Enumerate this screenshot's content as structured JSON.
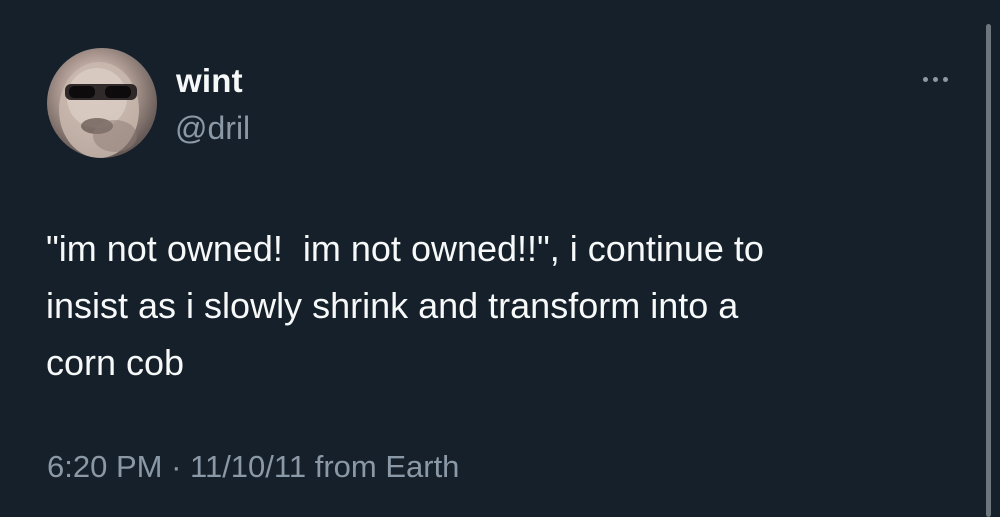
{
  "user": {
    "display_name": "wint",
    "handle": "@dril",
    "avatar_icon": "avatar-icon"
  },
  "tweet": {
    "text": "\"im not owned!  im not owned!!\", i continue to\ninsist as i slowly shrink and transform into a\ncorn cob",
    "time": "6:20 PM",
    "separator": " · ",
    "date": "11/10/11",
    "source": "from Earth"
  },
  "actions": {
    "more_icon": "more-horizontal-icon"
  },
  "colors": {
    "background": "#15202b",
    "primary_text": "#f7f9f9",
    "secondary_text": "#8b98a5"
  }
}
